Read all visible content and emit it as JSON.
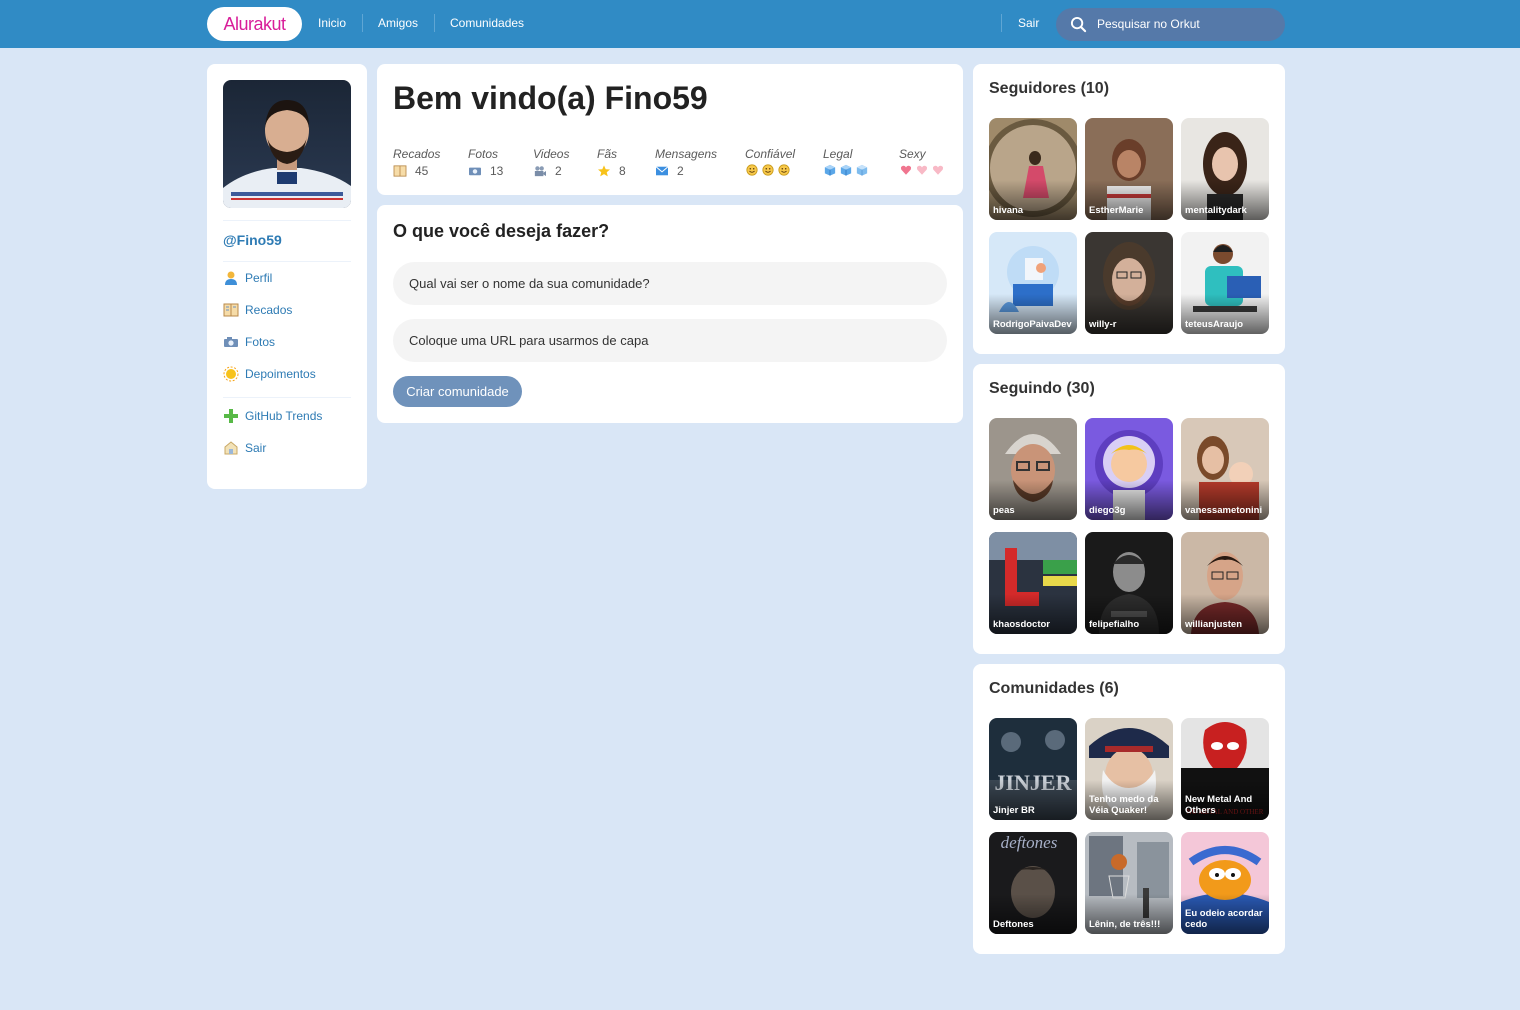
{
  "header": {
    "logo": "Alurakut",
    "nav": [
      "Inicio",
      "Amigos",
      "Comunidades"
    ],
    "logout": "Sair",
    "search_placeholder": "Pesquisar no Orkut"
  },
  "profile": {
    "handle": "@Fino59",
    "menu": [
      {
        "label": "Perfil",
        "icon": "user-icon"
      },
      {
        "label": "Recados",
        "icon": "book-icon"
      },
      {
        "label": "Fotos",
        "icon": "camera-icon"
      },
      {
        "label": "Depoimentos",
        "icon": "sun-icon"
      },
      {
        "label": "GitHub Trends",
        "icon": "plus-icon"
      },
      {
        "label": "Sair",
        "icon": "logout-icon"
      }
    ]
  },
  "welcome": {
    "title": "Bem vindo(a) Fino59",
    "stats": [
      {
        "label": "Recados",
        "value": "45",
        "icon": "book-icon"
      },
      {
        "label": "Fotos",
        "value": "13",
        "icon": "camera-icon"
      },
      {
        "label": "Videos",
        "value": "2",
        "icon": "video-camera-icon"
      },
      {
        "label": "Fãs",
        "value": "8",
        "icon": "star-icon"
      },
      {
        "label": "Mensagens",
        "value": "2",
        "icon": "envelope-icon"
      }
    ],
    "ratings": [
      {
        "label": "Confiável",
        "icon": "smile-icon",
        "level": 3,
        "max": 3
      },
      {
        "label": "Legal",
        "icon": "ice-cube-icon",
        "level": 3,
        "max": 3
      },
      {
        "label": "Sexy",
        "icon": "heart-icon",
        "level": 1,
        "max": 3
      }
    ]
  },
  "create_form": {
    "title": "O que você deseja fazer?",
    "name_placeholder": "Qual vai ser o nome da sua comunidade?",
    "url_placeholder": "Coloque uma URL para usarmos de capa",
    "submit_label": "Criar comunidade"
  },
  "followers": {
    "title": "Seguidores (10)",
    "items": [
      "hivana",
      "EstherMarie",
      "mentalitydark",
      "RodrigoPaivaDev",
      "willy-r",
      "teteusAraujo"
    ]
  },
  "following": {
    "title": "Seguindo (30)",
    "items": [
      "peas",
      "diego3g",
      "vanessametonini",
      "khaosdoctor",
      "felipefialho",
      "willianjusten"
    ]
  },
  "communities": {
    "title": "Comunidades (6)",
    "items": [
      "Jinjer BR",
      "Tenho medo da Véia Quaker!",
      "New Metal And Others",
      "Deftones",
      "Lênin, de três!!!",
      "Eu odeio acordar cedo"
    ]
  },
  "colors": {
    "header_bg": "#308BC5",
    "page_bg": "#D9E6F6",
    "link": "#2E7BB4",
    "logo_accent": "#D81D99",
    "button_bg": "#6F92BB"
  }
}
